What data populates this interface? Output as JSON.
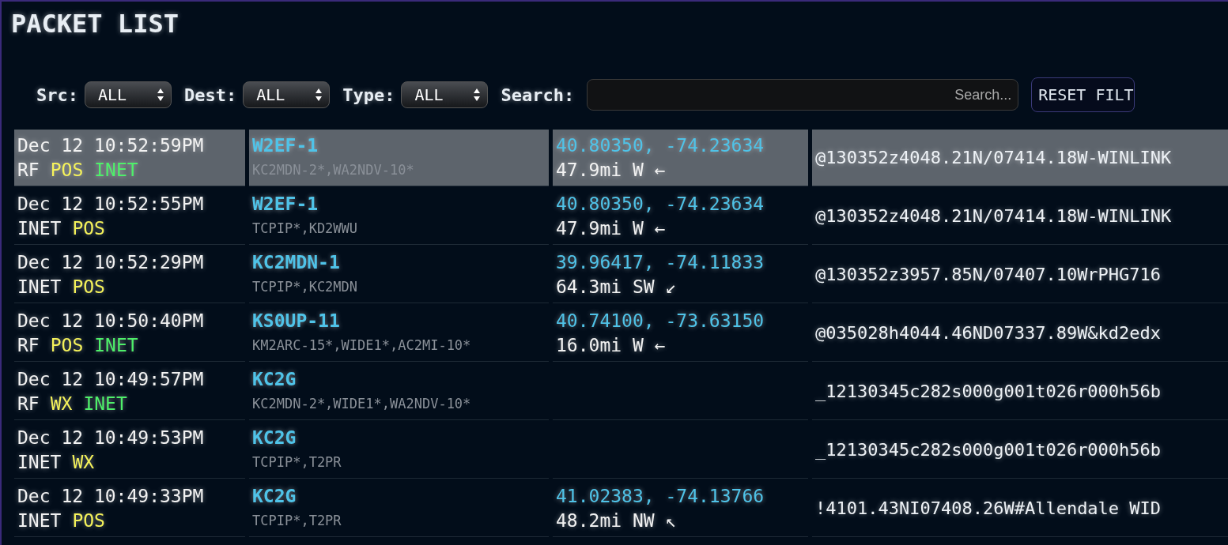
{
  "title": "PACKET LIST",
  "filters": [
    {
      "label": "Src:",
      "value": "ALL"
    },
    {
      "label": "Dest:",
      "value": "ALL"
    },
    {
      "label": "Type:",
      "value": "ALL"
    }
  ],
  "search": {
    "label": "Search:",
    "placeholder": "Search..."
  },
  "reset_button": "RESET FILT",
  "rows": [
    {
      "selected": true,
      "time": "Dec 12 10:52:59PM",
      "tags": [
        {
          "color": "#f2f2f2",
          "text": "RF"
        },
        {
          "color": "#f5f25a",
          "text": "POS"
        },
        {
          "color": "#4ef06a",
          "text": "INET"
        }
      ],
      "callsign": "W2EF-1",
      "path": "KC2MDN-2*,WA2NDV-10*",
      "coords": "40.80350, -74.23634",
      "distance": "47.9mi W ←",
      "raw": "@130352z4048.21N/07414.18W-WINLINK"
    },
    {
      "selected": false,
      "time": "Dec 12 10:52:55PM",
      "tags": [
        {
          "color": "#f2f2f2",
          "text": "INET"
        },
        {
          "color": "#f5f25a",
          "text": "POS"
        }
      ],
      "callsign": "W2EF-1",
      "path": "TCPIP*,KD2WWU",
      "coords": "40.80350, -74.23634",
      "distance": "47.9mi W ←",
      "raw": "@130352z4048.21N/07414.18W-WINLINK"
    },
    {
      "selected": false,
      "time": "Dec 12 10:52:29PM",
      "tags": [
        {
          "color": "#f2f2f2",
          "text": "INET"
        },
        {
          "color": "#f5f25a",
          "text": "POS"
        }
      ],
      "callsign": "KC2MDN-1",
      "path": "TCPIP*,KC2MDN",
      "coords": "39.96417, -74.11833",
      "distance": "64.3mi SW ↙",
      "raw": "@130352z3957.85N/07407.10WrPHG716"
    },
    {
      "selected": false,
      "time": "Dec 12 10:50:40PM",
      "tags": [
        {
          "color": "#f2f2f2",
          "text": "RF"
        },
        {
          "color": "#f5f25a",
          "text": "POS"
        },
        {
          "color": "#4ef06a",
          "text": "INET"
        }
      ],
      "callsign": "KS0UP-11",
      "path": "KM2ARC-15*,WIDE1*,AC2MI-10*",
      "coords": "40.74100, -73.63150",
      "distance": "16.0mi W ←",
      "raw": "@035028h4044.46ND07337.89W&kd2edx"
    },
    {
      "selected": false,
      "time": "Dec 12 10:49:57PM",
      "tags": [
        {
          "color": "#f2f2f2",
          "text": "RF"
        },
        {
          "color": "#f5f25a",
          "text": "WX"
        },
        {
          "color": "#4ef06a",
          "text": "INET"
        }
      ],
      "callsign": "KC2G",
      "path": "KC2MDN-2*,WIDE1*,WA2NDV-10*",
      "raw": "_12130345c282s000g001t026r000h56b"
    },
    {
      "selected": false,
      "time": "Dec 12 10:49:53PM",
      "tags": [
        {
          "color": "#f2f2f2",
          "text": "INET"
        },
        {
          "color": "#f5f25a",
          "text": "WX"
        }
      ],
      "callsign": "KC2G",
      "path": "TCPIP*,T2PR",
      "raw": "_12130345c282s000g001t026r000h56b"
    },
    {
      "selected": false,
      "time": "Dec 12 10:49:33PM",
      "tags": [
        {
          "color": "#f2f2f2",
          "text": "INET"
        },
        {
          "color": "#f5f25a",
          "text": "POS"
        }
      ],
      "callsign": "KC2G",
      "path": "TCPIP*,T2PR",
      "coords": "41.02383, -74.13766",
      "distance": "48.2mi NW ↖",
      "raw": "!4101.43NI07408.26W#Allendale WID"
    }
  ]
}
